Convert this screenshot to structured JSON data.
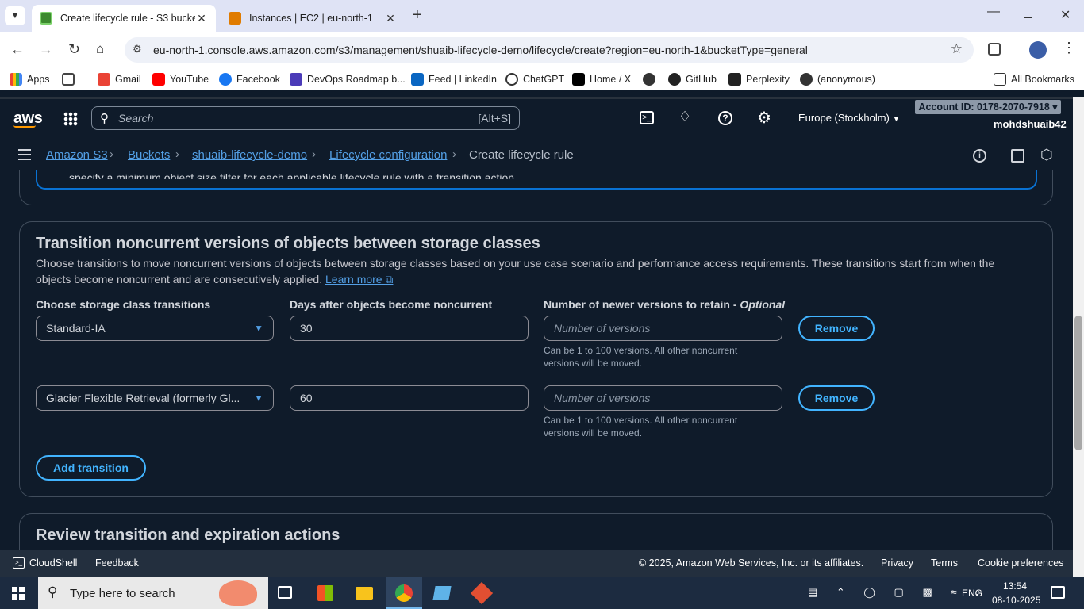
{
  "browser": {
    "tabs": [
      {
        "title": "Create lifecycle rule - S3 bucket",
        "active": true
      },
      {
        "title": "Instances | EC2 | eu-north-1",
        "active": false
      }
    ],
    "url": "eu-north-1.console.aws.amazon.com/s3/management/shuaib-lifecycle-demo/lifecycle/create?region=eu-north-1&bucketType=general",
    "bookmarks": [
      "Apps",
      "Gmail",
      "YouTube",
      "Facebook",
      "DevOps Roadmap b...",
      "Feed | LinkedIn",
      "ChatGPT",
      "Home / X",
      "GitHub",
      "Perplexity",
      "(anonymous)"
    ],
    "all_bookmarks": "All Bookmarks"
  },
  "aws_header": {
    "logo": "aws",
    "search_placeholder": "Search",
    "search_shortcut": "[Alt+S]",
    "region": "Europe (Stockholm)",
    "account": "Account ID: 0178-2070-7918",
    "user": "mohdshuaib42"
  },
  "breadcrumb": {
    "items": [
      "Amazon S3",
      "Buckets",
      "shuaib-lifecycle-demo",
      "Lifecycle configuration"
    ],
    "current": "Create lifecycle rule"
  },
  "partial_text": "specify a minimum object size filter for each applicable lifecycle rule with a transition action.",
  "transition_section": {
    "title": "Transition noncurrent versions of objects between storage classes",
    "description": "Choose transitions to move noncurrent versions of objects between storage classes based on your use case scenario and performance access requirements. These transitions start from when the objects become noncurrent and are consecutively applied.",
    "learn_more": "Learn more",
    "col1_label": "Choose storage class transitions",
    "col2_label": "Days after objects become noncurrent",
    "col3_label": "Number of newer versions to retain - ",
    "col3_optional": "Optional",
    "rows": [
      {
        "storage_class": "Standard-IA",
        "days": "30",
        "versions_placeholder": "Number of versions",
        "hint": "Can be 1 to 100 versions. All other noncurrent versions will be moved.",
        "remove": "Remove"
      },
      {
        "storage_class": "Glacier Flexible Retrieval (formerly Gl...",
        "days": "60",
        "versions_placeholder": "Number of versions",
        "hint": "Can be 1 to 100 versions. All other noncurrent versions will be moved.",
        "remove": "Remove"
      }
    ],
    "add_transition": "Add transition"
  },
  "review_section": {
    "title": "Review transition and expiration actions"
  },
  "footer": {
    "cloudshell": "CloudShell",
    "feedback": "Feedback",
    "copyright": "© 2025, Amazon Web Services, Inc. or its affiliates.",
    "privacy": "Privacy",
    "terms": "Terms",
    "cookie": "Cookie preferences"
  },
  "taskbar": {
    "search_placeholder": "Type here to search",
    "lang": "ENG",
    "time": "13:54",
    "date": "08-10-2025"
  },
  "colors": {
    "accent": "#539fe5",
    "button_border": "#42b4ff",
    "aws_orange": "#ff9900"
  }
}
